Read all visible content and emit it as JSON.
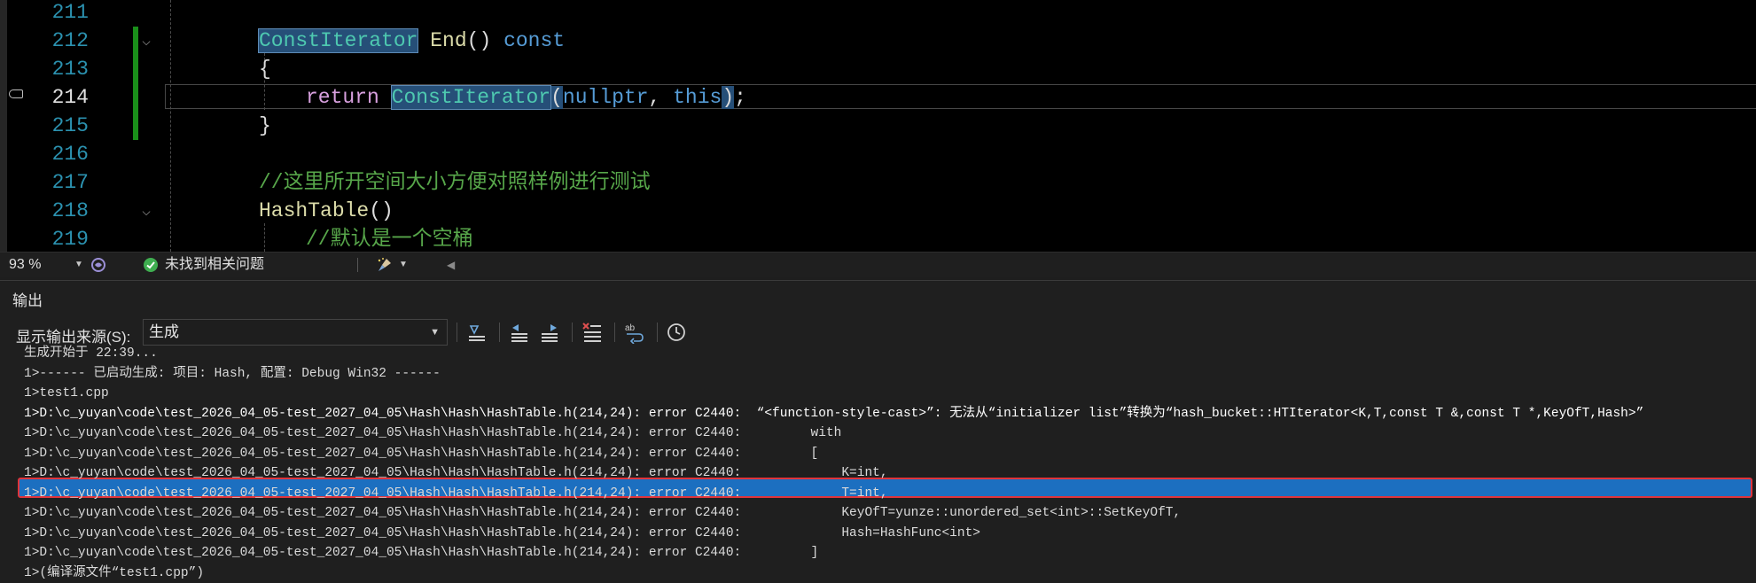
{
  "editor": {
    "lines": [
      {
        "num": "211",
        "tokens": []
      },
      {
        "num": "212",
        "tokens": [
          {
            "text": "ConstIterator",
            "cls": "t-type hl"
          },
          {
            "text": " End",
            "cls": "t-fn"
          },
          {
            "text": "() ",
            "cls": "t-plain"
          },
          {
            "text": "const",
            "cls": "t-kw"
          }
        ]
      },
      {
        "num": "213",
        "tokens": [
          {
            "text": "{",
            "cls": "t-plain"
          }
        ]
      },
      {
        "num": "214",
        "tokens": [
          {
            "text": "return",
            "cls": "t-ret"
          },
          {
            "text": " ",
            "cls": "t-plain"
          },
          {
            "text": "ConstIterator",
            "cls": "t-type hl"
          },
          {
            "text": "(",
            "cls": "t-plain hl-paren"
          },
          {
            "text": "nullptr",
            "cls": "t-kw"
          },
          {
            "text": ", ",
            "cls": "t-plain"
          },
          {
            "text": "this",
            "cls": "t-kw"
          },
          {
            "text": ")",
            "cls": "t-plain hl-paren"
          },
          {
            "text": ";",
            "cls": "t-plain"
          }
        ]
      },
      {
        "num": "215",
        "tokens": [
          {
            "text": "}",
            "cls": "t-plain"
          }
        ]
      },
      {
        "num": "216",
        "tokens": []
      },
      {
        "num": "217",
        "tokens": [
          {
            "text": "//这里所开空间大小方便对照样例进行测试",
            "cls": "t-cmt"
          }
        ]
      },
      {
        "num": "218",
        "tokens": [
          {
            "text": "HashTable",
            "cls": "t-fn"
          },
          {
            "text": "()",
            "cls": "t-plain"
          }
        ]
      },
      {
        "num": "219",
        "tokens": [
          {
            "text": "//默认是一个空桶",
            "cls": "t-cmt"
          }
        ]
      }
    ]
  },
  "status": {
    "zoom": "93 %",
    "issues": "未找到相关问题"
  },
  "output": {
    "title": "输出",
    "source_label": "显示输出来源(S):",
    "source_value": "生成",
    "log": [
      "生成开始于 22:39...",
      "1>------ 已启动生成: 项目: Hash, 配置: Debug Win32 ------",
      "1>test1.cpp",
      "1>D:\\c_yuyan\\code\\test_2026_04_05-test_2027_04_05\\Hash\\Hash\\HashTable.h(214,24): error C2440:  “<function-style-cast>”: 无法从“initializer list”转换为“hash_bucket::HTIterator<K,T,const T &,const T *,KeyOfT,Hash>”",
      "1>D:\\c_yuyan\\code\\test_2026_04_05-test_2027_04_05\\Hash\\Hash\\HashTable.h(214,24): error C2440:         with",
      "1>D:\\c_yuyan\\code\\test_2026_04_05-test_2027_04_05\\Hash\\Hash\\HashTable.h(214,24): error C2440:         [",
      "1>D:\\c_yuyan\\code\\test_2026_04_05-test_2027_04_05\\Hash\\Hash\\HashTable.h(214,24): error C2440:             K=int,",
      "1>D:\\c_yuyan\\code\\test_2026_04_05-test_2027_04_05\\Hash\\Hash\\HashTable.h(214,24): error C2440:             T=int,",
      "1>D:\\c_yuyan\\code\\test_2026_04_05-test_2027_04_05\\Hash\\Hash\\HashTable.h(214,24): error C2440:             KeyOfT=yunze::unordered_set<int>::SetKeyOfT,",
      "1>D:\\c_yuyan\\code\\test_2026_04_05-test_2027_04_05\\Hash\\Hash\\HashTable.h(214,24): error C2440:             Hash=HashFunc<int>",
      "1>D:\\c_yuyan\\code\\test_2026_04_05-test_2027_04_05\\Hash\\Hash\\HashTable.h(214,24): error C2440:         ]",
      "1>(编译源文件“test1.cpp”)"
    ]
  }
}
